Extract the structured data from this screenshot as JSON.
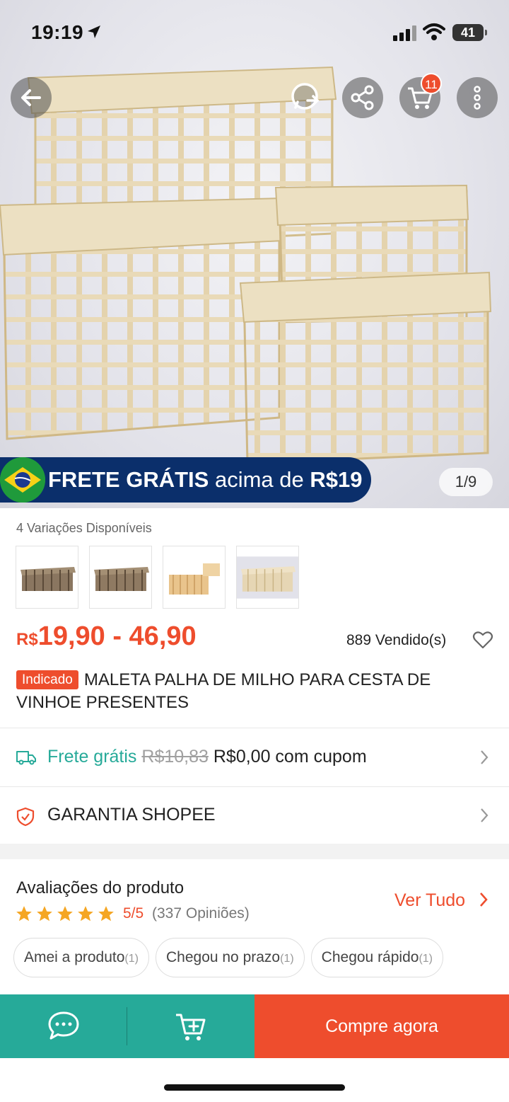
{
  "status": {
    "time": "19:19",
    "battery": "41"
  },
  "header": {
    "cart_count": "11"
  },
  "banner": {
    "free_shipping_bold": "FRETE GRÁTIS",
    "free_shipping_rest": " acima de ",
    "free_shipping_amount": "R$19"
  },
  "gallery": {
    "page": "1/9"
  },
  "product": {
    "variants_label": "4 Variações Disponíveis",
    "price_currency": "R$",
    "price_range": "19,90 - 46,90",
    "sold": "889 Vendido(s)",
    "badge": "Indicado",
    "title": "MALETA  PALHA DE MILHO PARA CESTA DE VINHOE PRESENTES"
  },
  "shipping": {
    "label": "Frete grátis",
    "old_price": "R$10,83",
    "new_price": "R$0,00 com cupom"
  },
  "guarantee": {
    "label": "GARANTIA SHOPEE"
  },
  "reviews": {
    "title": "Avaliações do produto",
    "see_all": "Ver Tudo",
    "rating": "5/5",
    "count": "(337 Opiniões)",
    "chips": [
      {
        "label": "Amei a produto",
        "count": "(1)"
      },
      {
        "label": "Chegou no prazo",
        "count": "(1)"
      },
      {
        "label": "Chegou rápido",
        "count": "(1)"
      }
    ]
  },
  "bottom_bar": {
    "buy_now": "Compre agora"
  },
  "colors": {
    "accent": "#ee4d2d",
    "teal": "#26aa99",
    "banner_blue": "#0b2f6b"
  }
}
